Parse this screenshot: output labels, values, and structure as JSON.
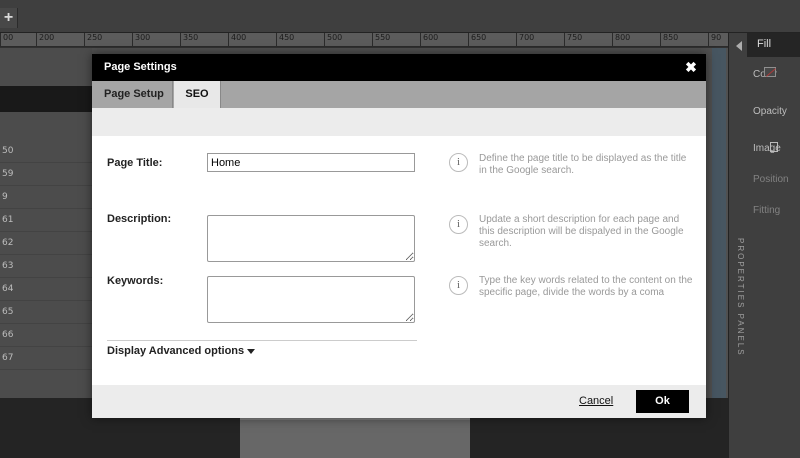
{
  "editor": {
    "ruler_ticks": [
      "00",
      "200",
      "250",
      "300",
      "350",
      "400",
      "450",
      "500",
      "550",
      "600",
      "650",
      "700",
      "750",
      "800",
      "850",
      "90"
    ],
    "row_numbers": [
      "50",
      "59",
      "9",
      "61",
      "62",
      "63",
      "64",
      "65",
      "66",
      "67"
    ]
  },
  "properties_panel": {
    "tab_label": "Fill",
    "vertical_label": "PROPERTIES PANELS",
    "items": [
      "Color",
      "Opacity",
      "Image",
      "Position",
      "Fitting"
    ]
  },
  "modal": {
    "title": "Page Settings",
    "close_symbol": "✖",
    "tabs": [
      {
        "label": "Page Setup",
        "active": false
      },
      {
        "label": "SEO",
        "active": true
      }
    ],
    "fields": {
      "page_title": {
        "label": "Page Title:",
        "value": "Home",
        "help": "Define the page title to be displayed as the title in the Google search."
      },
      "description": {
        "label": "Description:",
        "value": "",
        "help": "Update a short description for each page and this description will be dispalyed in the Google search."
      },
      "keywords": {
        "label": "Keywords:",
        "value": "",
        "help": "Type the key words related to the content on the specific page, divide the words by a coma"
      }
    },
    "info_symbol": "i",
    "advanced_toggle": "Display Advanced options",
    "cancel_label": "Cancel",
    "ok_label": "Ok"
  }
}
